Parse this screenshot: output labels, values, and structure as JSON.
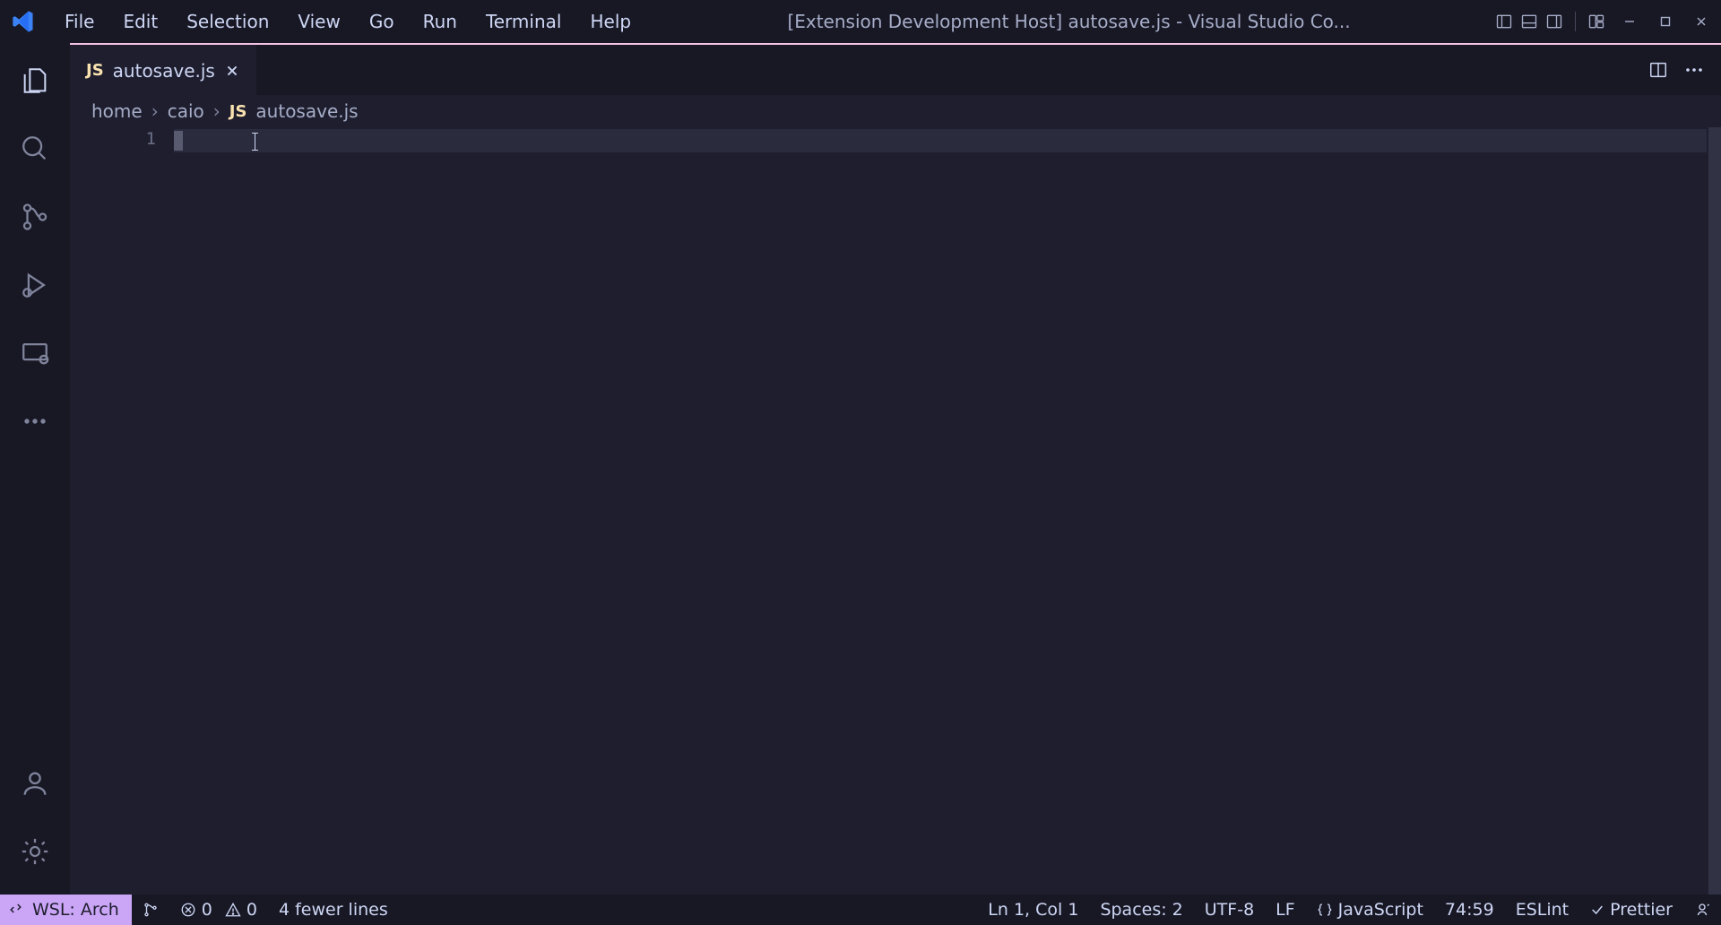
{
  "menubar": {
    "items": [
      "File",
      "Edit",
      "Selection",
      "View",
      "Go",
      "Run",
      "Terminal",
      "Help"
    ],
    "title": "[Extension Development Host] autosave.js - Visual Studio Co..."
  },
  "tabs": [
    {
      "lang_badge": "JS",
      "label": "autosave.js"
    }
  ],
  "breadcrumb": {
    "seg0": "home",
    "seg1": "caio",
    "seg2_badge": "JS",
    "seg2_label": "autosave.js"
  },
  "editor": {
    "line_numbers": [
      "1"
    ]
  },
  "statusbar": {
    "remote_label": "WSL: Arch",
    "errors": "0",
    "warnings": "0",
    "diff_summary": "4 fewer lines",
    "cursor_pos": "Ln 1, Col 1",
    "indent": "Spaces: 2",
    "encoding": "UTF-8",
    "eol": "LF",
    "language": "JavaScript",
    "port": "74:59",
    "lint": "ESLint",
    "formatter": "Prettier"
  }
}
